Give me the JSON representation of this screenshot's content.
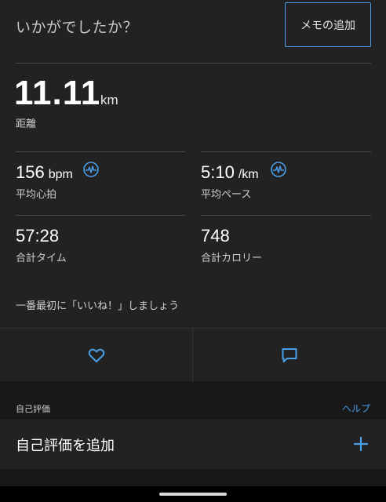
{
  "header": {
    "question": "いかがでしたか？",
    "memo_button": "メモの追加"
  },
  "distance": {
    "value": "11.11",
    "unit": "km",
    "label": "距離"
  },
  "stats": {
    "heart_rate": {
      "value": "156",
      "unit": "bpm",
      "label": "平均心拍"
    },
    "pace": {
      "value": "5:10",
      "unit": "/km",
      "label": "平均ペース"
    },
    "time": {
      "value": "57:28",
      "label": "合計タイム"
    },
    "calories": {
      "value": "748",
      "label": "合計カロリー"
    }
  },
  "social": {
    "like_prompt": "一番最初に「いいね！」しましょう"
  },
  "self_evaluation": {
    "section_label": "自己評価",
    "help_link": "ヘルプ",
    "add_label": "自己評価を追加"
  },
  "colors": {
    "accent": "#4a9fe8",
    "background": "#181818",
    "card": "#222222"
  },
  "icons": [
    "heart-rate-pulse-icon",
    "pace-pulse-icon",
    "heart-icon",
    "comment-icon",
    "plus-icon"
  ]
}
